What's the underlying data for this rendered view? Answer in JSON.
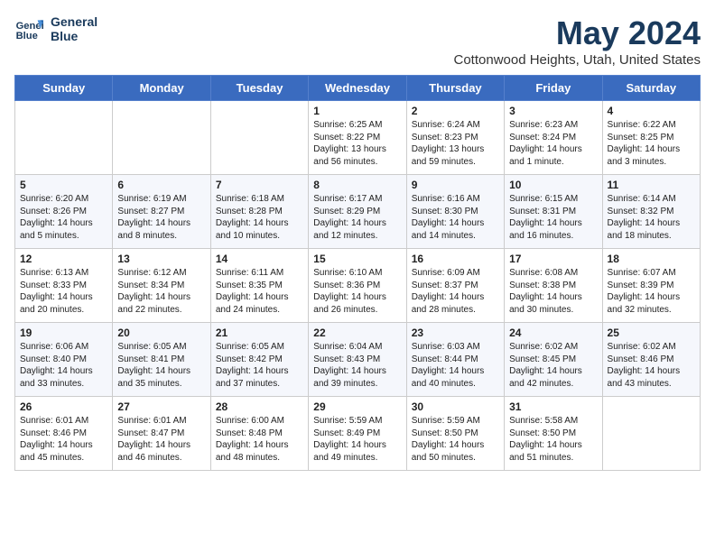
{
  "header": {
    "logo_line1": "General",
    "logo_line2": "Blue",
    "month_title": "May 2024",
    "location": "Cottonwood Heights, Utah, United States"
  },
  "days_of_week": [
    "Sunday",
    "Monday",
    "Tuesday",
    "Wednesday",
    "Thursday",
    "Friday",
    "Saturday"
  ],
  "weeks": [
    [
      {
        "day": "",
        "content": ""
      },
      {
        "day": "",
        "content": ""
      },
      {
        "day": "",
        "content": ""
      },
      {
        "day": "1",
        "content": "Sunrise: 6:25 AM\nSunset: 8:22 PM\nDaylight: 13 hours and 56 minutes."
      },
      {
        "day": "2",
        "content": "Sunrise: 6:24 AM\nSunset: 8:23 PM\nDaylight: 13 hours and 59 minutes."
      },
      {
        "day": "3",
        "content": "Sunrise: 6:23 AM\nSunset: 8:24 PM\nDaylight: 14 hours and 1 minute."
      },
      {
        "day": "4",
        "content": "Sunrise: 6:22 AM\nSunset: 8:25 PM\nDaylight: 14 hours and 3 minutes."
      }
    ],
    [
      {
        "day": "5",
        "content": "Sunrise: 6:20 AM\nSunset: 8:26 PM\nDaylight: 14 hours and 5 minutes."
      },
      {
        "day": "6",
        "content": "Sunrise: 6:19 AM\nSunset: 8:27 PM\nDaylight: 14 hours and 8 minutes."
      },
      {
        "day": "7",
        "content": "Sunrise: 6:18 AM\nSunset: 8:28 PM\nDaylight: 14 hours and 10 minutes."
      },
      {
        "day": "8",
        "content": "Sunrise: 6:17 AM\nSunset: 8:29 PM\nDaylight: 14 hours and 12 minutes."
      },
      {
        "day": "9",
        "content": "Sunrise: 6:16 AM\nSunset: 8:30 PM\nDaylight: 14 hours and 14 minutes."
      },
      {
        "day": "10",
        "content": "Sunrise: 6:15 AM\nSunset: 8:31 PM\nDaylight: 14 hours and 16 minutes."
      },
      {
        "day": "11",
        "content": "Sunrise: 6:14 AM\nSunset: 8:32 PM\nDaylight: 14 hours and 18 minutes."
      }
    ],
    [
      {
        "day": "12",
        "content": "Sunrise: 6:13 AM\nSunset: 8:33 PM\nDaylight: 14 hours and 20 minutes."
      },
      {
        "day": "13",
        "content": "Sunrise: 6:12 AM\nSunset: 8:34 PM\nDaylight: 14 hours and 22 minutes."
      },
      {
        "day": "14",
        "content": "Sunrise: 6:11 AM\nSunset: 8:35 PM\nDaylight: 14 hours and 24 minutes."
      },
      {
        "day": "15",
        "content": "Sunrise: 6:10 AM\nSunset: 8:36 PM\nDaylight: 14 hours and 26 minutes."
      },
      {
        "day": "16",
        "content": "Sunrise: 6:09 AM\nSunset: 8:37 PM\nDaylight: 14 hours and 28 minutes."
      },
      {
        "day": "17",
        "content": "Sunrise: 6:08 AM\nSunset: 8:38 PM\nDaylight: 14 hours and 30 minutes."
      },
      {
        "day": "18",
        "content": "Sunrise: 6:07 AM\nSunset: 8:39 PM\nDaylight: 14 hours and 32 minutes."
      }
    ],
    [
      {
        "day": "19",
        "content": "Sunrise: 6:06 AM\nSunset: 8:40 PM\nDaylight: 14 hours and 33 minutes."
      },
      {
        "day": "20",
        "content": "Sunrise: 6:05 AM\nSunset: 8:41 PM\nDaylight: 14 hours and 35 minutes."
      },
      {
        "day": "21",
        "content": "Sunrise: 6:05 AM\nSunset: 8:42 PM\nDaylight: 14 hours and 37 minutes."
      },
      {
        "day": "22",
        "content": "Sunrise: 6:04 AM\nSunset: 8:43 PM\nDaylight: 14 hours and 39 minutes."
      },
      {
        "day": "23",
        "content": "Sunrise: 6:03 AM\nSunset: 8:44 PM\nDaylight: 14 hours and 40 minutes."
      },
      {
        "day": "24",
        "content": "Sunrise: 6:02 AM\nSunset: 8:45 PM\nDaylight: 14 hours and 42 minutes."
      },
      {
        "day": "25",
        "content": "Sunrise: 6:02 AM\nSunset: 8:46 PM\nDaylight: 14 hours and 43 minutes."
      }
    ],
    [
      {
        "day": "26",
        "content": "Sunrise: 6:01 AM\nSunset: 8:46 PM\nDaylight: 14 hours and 45 minutes."
      },
      {
        "day": "27",
        "content": "Sunrise: 6:01 AM\nSunset: 8:47 PM\nDaylight: 14 hours and 46 minutes."
      },
      {
        "day": "28",
        "content": "Sunrise: 6:00 AM\nSunset: 8:48 PM\nDaylight: 14 hours and 48 minutes."
      },
      {
        "day": "29",
        "content": "Sunrise: 5:59 AM\nSunset: 8:49 PM\nDaylight: 14 hours and 49 minutes."
      },
      {
        "day": "30",
        "content": "Sunrise: 5:59 AM\nSunset: 8:50 PM\nDaylight: 14 hours and 50 minutes."
      },
      {
        "day": "31",
        "content": "Sunrise: 5:58 AM\nSunset: 8:50 PM\nDaylight: 14 hours and 51 minutes."
      },
      {
        "day": "",
        "content": ""
      }
    ]
  ]
}
